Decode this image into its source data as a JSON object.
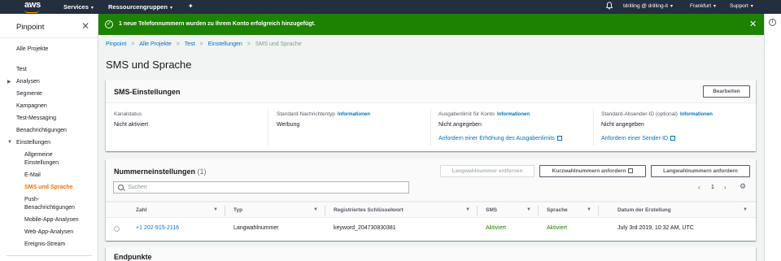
{
  "topnav": {
    "logo": "aws",
    "services": "Services",
    "resource_groups": "Ressourcengruppen",
    "pin": "✦",
    "user": "tdrilling @ drilling-it",
    "region": "Frankfurt",
    "support": "Support",
    "caret": "▾"
  },
  "sidebar": {
    "title": "Pinpoint",
    "close": "✕",
    "all_projects": "Alle Projekte",
    "project": "Test",
    "items": [
      "Analysen",
      "Segmente",
      "Kampagnen",
      "Test-Messaging",
      "Benachrichtigungen",
      "Einstellungen"
    ],
    "settings_sub": [
      "Allgemeine",
      "Einstellungen",
      "E-Mail",
      "SMS und Sprache",
      "Push-",
      "Benachrichtigungen",
      "Mobile-App-Analysen",
      "Web-App-Analysen",
      "Ereignis-Stream"
    ],
    "arrow_right": "▶",
    "arrow_down": "▼"
  },
  "flash": {
    "icon": "✓",
    "message": "1 neue Telefonnummern wurden zu Ihrem Konto erfolgreich hinzugefügt.",
    "close": "✕"
  },
  "breadcrumb": [
    "Pinpoint",
    "Alle Projekte",
    "Test",
    "Einstellungen",
    "SMS und Sprache"
  ],
  "breadcrumb_sep": ">",
  "page_title": "SMS und Sprache",
  "sms_settings": {
    "title": "SMS-Einstellungen",
    "edit_button": "Bearbeiten",
    "info_label": "Informationen",
    "channel_status_label": "Kanalstatus",
    "channel_status_value": "Nicht aktiviert",
    "default_message_type_label": "Standard-Nachrichtentyp",
    "default_message_type_value": "Werbung",
    "spend_limit_label": "Ausgabenlimit für Konto",
    "spend_limit_value": "Nicht angegeben",
    "spend_limit_link": "Anfordern einer Erhöhung des Ausgabenlimits",
    "sender_id_label": "Standard-Absender-ID (optional)",
    "sender_id_value": "Nicht angegeben",
    "sender_id_link": "Anfordern einer Sender-ID"
  },
  "number_settings": {
    "title": "Nummerneinstellungen",
    "count": "(1)",
    "remove_button": "Langwahlnummer entfernen",
    "short_code_button": "Kurzwahlnummern anfordern",
    "long_code_button": "Langwahlnummern anfordern",
    "search_placeholder": "Suchen",
    "pager_prev": "‹",
    "pager_page": "1",
    "pager_next": "›",
    "settings_icon": "⚙",
    "sort_icon": "▼",
    "columns": [
      "Zahl",
      "Typ",
      "Registriertes Schlüsselwort",
      "SMS",
      "Sprache",
      "Datum der Erstellung"
    ],
    "rows": [
      {
        "number": "+1 202-915-2116",
        "type": "Langwahlnummer",
        "keyword": "keyword_204730830381",
        "sms": "Aktiviert",
        "voice": "Aktiviert",
        "created": "July 3rd 2019, 10:32 AM, UTC"
      }
    ]
  },
  "endpoints": {
    "title": "Endpunkte"
  },
  "info_panel_icon": "i",
  "colors": {
    "nav_bg": "#232f3e",
    "aws_orange": "#ff9900",
    "flash_green": "#1d8102",
    "link_blue": "#0073bb",
    "active_orange": "#ec7211",
    "status_green": "#1d8102"
  }
}
